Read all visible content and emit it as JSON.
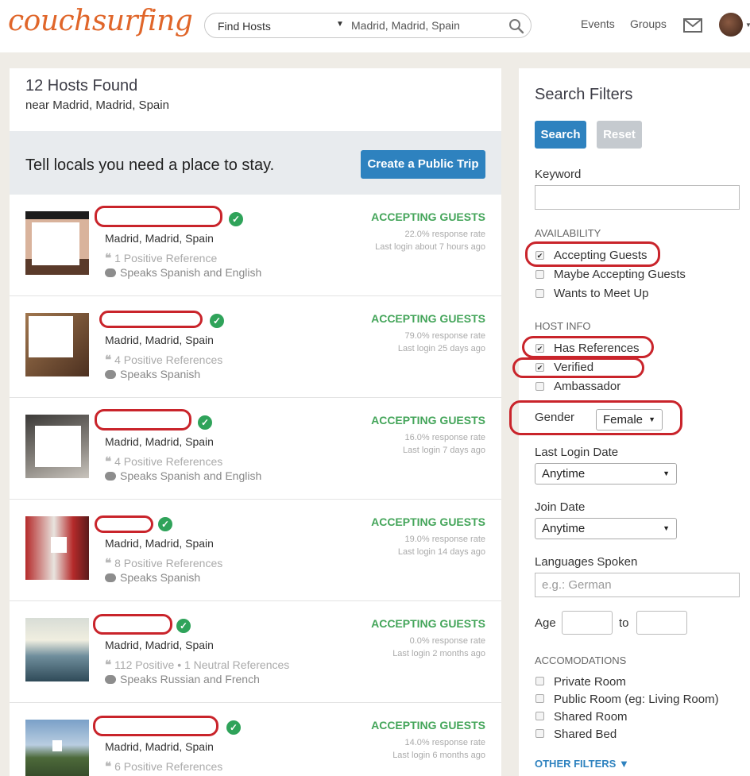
{
  "header": {
    "logo": "couchsurfing",
    "search_mode": "Find Hosts",
    "search_location": "Madrid, Madrid, Spain",
    "nav": [
      "Events",
      "Groups"
    ]
  },
  "results": {
    "title": "12 Hosts Found",
    "subtitle": "near Madrid, Madrid, Spain",
    "banner_text": "Tell locals you need a place to stay.",
    "banner_button": "Create a Public Trip",
    "hosts": [
      {
        "location": "Madrid, Madrid, Spain",
        "references": "1 Positive Reference",
        "languages": "Speaks Spanish and English",
        "status": "ACCEPTING GUESTS",
        "response_rate": "22.0% response rate",
        "last_login": "Last login about 7 hours ago"
      },
      {
        "location": "Madrid, Madrid, Spain",
        "references": "4 Positive References",
        "languages": "Speaks Spanish",
        "status": "ACCEPTING GUESTS",
        "response_rate": "79.0% response rate",
        "last_login": "Last login 25 days ago"
      },
      {
        "location": "Madrid, Madrid, Spain",
        "references": "4 Positive References",
        "languages": "Speaks Spanish and English",
        "status": "ACCEPTING GUESTS",
        "response_rate": "16.0% response rate",
        "last_login": "Last login 7 days ago"
      },
      {
        "location": "Madrid, Madrid, Spain",
        "references": "8 Positive References",
        "languages": "Speaks Spanish",
        "status": "ACCEPTING GUESTS",
        "response_rate": "19.0% response rate",
        "last_login": "Last login 14 days ago"
      },
      {
        "location": "Madrid, Madrid, Spain",
        "references": "112 Positive • 1 Neutral References",
        "languages": "Speaks Russian and French",
        "status": "ACCEPTING GUESTS",
        "response_rate": "0.0% response rate",
        "last_login": "Last login 2 months ago"
      },
      {
        "location": "Madrid, Madrid, Spain",
        "references": "6 Positive References",
        "languages": "",
        "status": "ACCEPTING GUESTS",
        "response_rate": "14.0% response rate",
        "last_login": "Last login 6 months ago"
      }
    ]
  },
  "filters": {
    "title": "Search Filters",
    "search_button": "Search",
    "reset_button": "Reset",
    "keyword_label": "Keyword",
    "availability_heading": "AVAILABILITY",
    "availability": [
      {
        "label": "Accepting Guests",
        "checked": true
      },
      {
        "label": "Maybe Accepting Guests",
        "checked": false
      },
      {
        "label": "Wants to Meet Up",
        "checked": false
      }
    ],
    "hostinfo_heading": "HOST INFO",
    "hostinfo": [
      {
        "label": "Has References",
        "checked": true
      },
      {
        "label": "Verified",
        "checked": true
      },
      {
        "label": "Ambassador",
        "checked": false
      }
    ],
    "gender_label": "Gender",
    "gender_value": "Female",
    "last_login_label": "Last Login Date",
    "last_login_value": "Anytime",
    "join_date_label": "Join Date",
    "join_date_value": "Anytime",
    "languages_label": "Languages Spoken",
    "languages_placeholder": "e.g.: German",
    "age_label": "Age",
    "age_to": "to",
    "accommodations_heading": "ACCOMODATIONS",
    "accommodations": [
      {
        "label": "Private Room",
        "checked": false
      },
      {
        "label": "Public Room (eg: Living Room)",
        "checked": false
      },
      {
        "label": "Shared Room",
        "checked": false
      },
      {
        "label": "Shared Bed",
        "checked": false
      }
    ],
    "other_filters": "OTHER FILTERS"
  },
  "colors": {
    "brand": "#e0662a",
    "accent": "#2e82bf",
    "accepting": "#44a55a",
    "highlight": "#c9242b"
  }
}
